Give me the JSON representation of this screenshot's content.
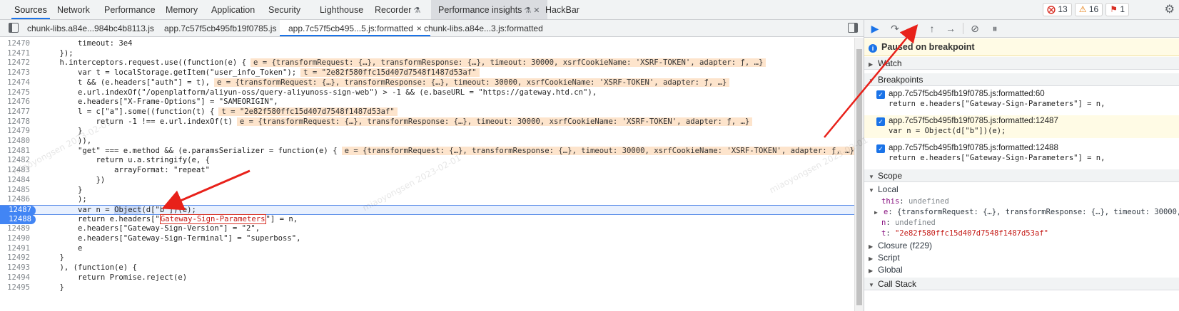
{
  "top_tabs": [
    "Sources",
    "Network",
    "Performance",
    "Memory",
    "Application",
    "Security",
    "Lighthouse",
    "Recorder",
    "Performance insights",
    "HackBar"
  ],
  "recorder_icon": "flask-icon",
  "insights_icon": "flask-icon",
  "status": {
    "errors": "13",
    "warnings": "16",
    "issues": "1"
  },
  "file_tabs": [
    "chunk-libs.a84e...984bc4b8113.js",
    "app.7c57f5cb495fb19f0785.js",
    "app.7c57f5cb495...5.js:formatted",
    "chunk-libs.a84e...3.js:formatted"
  ],
  "file_tab_close": "×",
  "code_lines": [
    {
      "n": "12470",
      "src": "        timeout: 3e4",
      "v": ""
    },
    {
      "n": "12471",
      "src": "    });",
      "v": ""
    },
    {
      "n": "12472",
      "src": "    h.interceptors.request.use((function(e) {",
      "v": "e = {transformRequest: {…}, transformResponse: {…}, timeout: 30000, xsrfCookieName: 'XSRF-TOKEN', adapter: ƒ, …}"
    },
    {
      "n": "12473",
      "src": "        var t = localStorage.getItem(\"user_info_Token\");",
      "v": "t = \"2e82f580ffc15d407d7548f1487d53af\""
    },
    {
      "n": "12474",
      "src": "        t && (e.headers[\"auth\"] = t),",
      "v": "e = {transformRequest: {…}, transformResponse: {…}, timeout: 30000, xsrfCookieName: 'XSRF-TOKEN', adapter: ƒ, …}"
    },
    {
      "n": "12475",
      "src": "        e.url.indexOf(\"/openplatform/aliyun-oss/query-aliyunoss-sign-web\") > -1 && (e.baseURL = \"https://gateway.htd.cn\"),",
      "v": ""
    },
    {
      "n": "12476",
      "src": "        e.headers[\"X-Frame-Options\"] = \"SAMEORIGIN\",",
      "v": ""
    },
    {
      "n": "12477",
      "src": "        l = c[\"a\"].some((function(t) {",
      "v": "t = \"2e82f580ffc15d407d7548f1487d53af\""
    },
    {
      "n": "12478",
      "src": "            return -1 !== e.url.indexOf(t)",
      "v": "e = {transformRequest: {…}, transformResponse: {…}, timeout: 30000, xsrfCookieName: 'XSRF-TOKEN', adapter: ƒ, …}"
    },
    {
      "n": "12479",
      "src": "        }",
      "v": ""
    },
    {
      "n": "12480",
      "src": "        )),",
      "v": ""
    },
    {
      "n": "12481",
      "src": "        \"get\" === e.method && (e.paramsSerializer = function(e) {",
      "v": "e = {transformRequest: {…}, transformResponse: {…}, timeout: 30000, xsrfCookieName: 'XSRF-TOKEN', adapter: ƒ, …}"
    },
    {
      "n": "12482",
      "src": "            return u.a.stringify(e, {",
      "v": ""
    },
    {
      "n": "12483",
      "src": "                arrayFormat: \"repeat\"",
      "v": ""
    },
    {
      "n": "12484",
      "src": "            })",
      "v": ""
    },
    {
      "n": "12485",
      "src": "        }",
      "v": ""
    },
    {
      "n": "12486",
      "src": "        );",
      "v": ""
    },
    {
      "n": "12487",
      "src": "",
      "v": ""
    },
    {
      "n": "12488",
      "src": "",
      "v": ""
    },
    {
      "n": "12489",
      "src": "        e.headers[\"Gateway-Sign-Version\"] = \"2\",",
      "v": ""
    },
    {
      "n": "12490",
      "src": "        e.headers[\"Gateway-Sign-Terminal\"] = \"superboss\",",
      "v": ""
    },
    {
      "n": "12491",
      "src": "        e",
      "v": ""
    },
    {
      "n": "12492",
      "src": "    }",
      "v": ""
    },
    {
      "n": "12493",
      "src": "    ), (function(e) {",
      "v": ""
    },
    {
      "n": "12494",
      "src": "        return Promise.reject(e)",
      "v": ""
    },
    {
      "n": "12495",
      "src": "    }",
      "v": ""
    }
  ],
  "line_12487": {
    "pre": "        var n = ",
    "obj": "Object",
    "mid": "(d[\"b\"])",
    "post": "(e);"
  },
  "line_12488": {
    "pre": "        return e.headers[\"",
    "key": "Gateway-Sign-Parameters",
    "post": "\"] = n,"
  },
  "watermark": [
    "miaoyongsen 2023-02-01",
    "miaoyongsen 2023-02-01",
    "miaoyongsen 2023-02-01"
  ],
  "debugger": {
    "paused": "Paused on breakpoint",
    "info_glyph": "i",
    "sections": {
      "watch": "Watch",
      "breakpoints": "Breakpoints",
      "scope": "Scope",
      "call_stack": "Call Stack"
    },
    "breakpoints": [
      {
        "loc": "app.7c57f5cb495fb19f0785.js:formatted:60",
        "code": "return e.headers[\"Gateway-Sign-Parameters\"] = n,"
      },
      {
        "loc": "app.7c57f5cb495fb19f0785.js:formatted:12487",
        "code": "var n = Object(d[\"b\"])(e);"
      },
      {
        "loc": "app.7c57f5cb495fb19f0785.js:formatted:12488",
        "code": "return e.headers[\"Gateway-Sign-Parameters\"] = n,"
      }
    ],
    "scope": {
      "local": "Local",
      "this_k": "this",
      "this_v": "undefined",
      "e_k": "e",
      "e_v": "{transformRequest: {…}, transformResponse: {…}, timeout: 30000, xsrfCookieName: 'XSRF-TOKEN', adapter: ƒ, …}",
      "n_k": "n",
      "n_v": "undefined",
      "t_k": "t",
      "t_v": "\"2e82f580ffc15d407d7548f1487d53af\"",
      "closure": "Closure (f229)",
      "script": "Script",
      "global": "Global"
    }
  },
  "colors": {
    "accent": "#1a73e8",
    "breakpoint": "#4285f4",
    "paused_bg": "#fffbe5",
    "value_bg": "#fde4cc",
    "annotation": "#e8211a"
  }
}
